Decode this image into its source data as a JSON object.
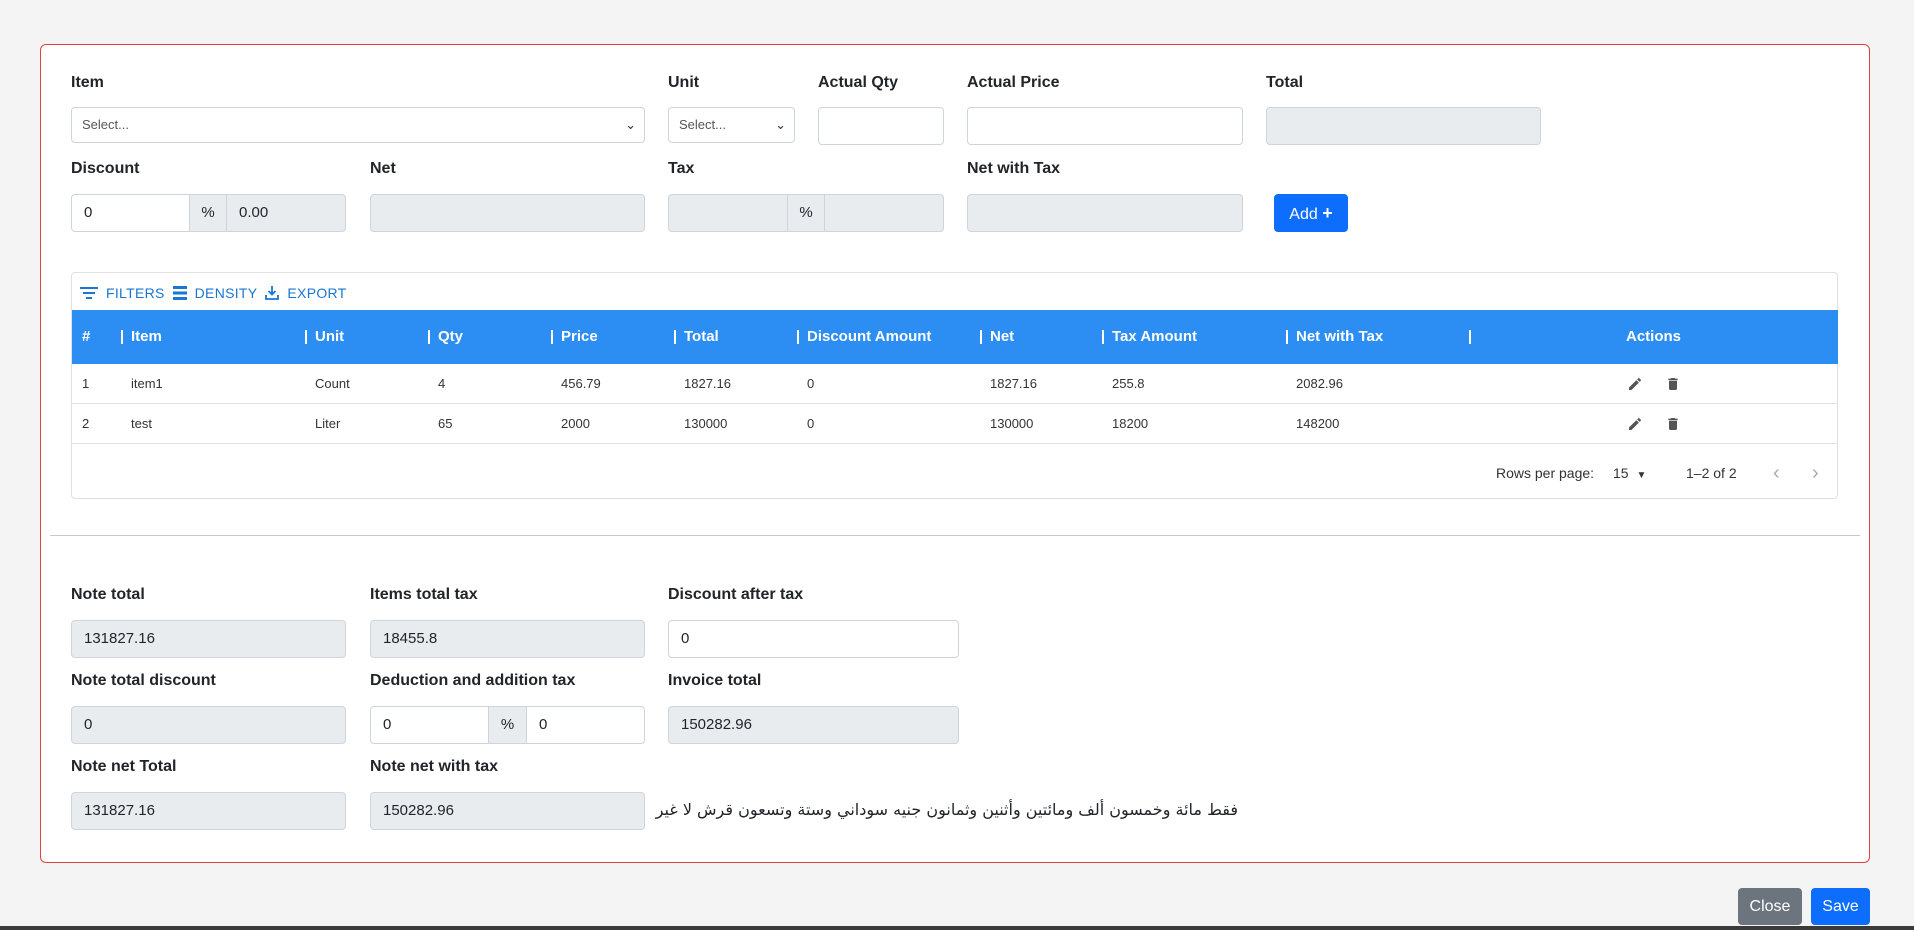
{
  "form": {
    "item_label": "Item",
    "item_placeholder": "Select...",
    "unit_label": "Unit",
    "unit_placeholder": "Select...",
    "actual_qty_label": "Actual Qty",
    "actual_qty_value": "",
    "actual_price_label": "Actual Price",
    "actual_price_value": "",
    "total_label": "Total",
    "total_value": "",
    "discount_label": "Discount",
    "discount_value": "0",
    "discount_percent_symbol": "%",
    "discount_amount": "0.00",
    "net_label": "Net",
    "net_value": "",
    "tax_label": "Tax",
    "tax_value": "",
    "tax_percent_symbol": "%",
    "tax_amount": "",
    "net_with_tax_label": "Net with Tax",
    "net_with_tax_value": "",
    "add_label": "Add",
    "add_icon": "plus-icon"
  },
  "toolbar": {
    "filters_label": "FILTERS",
    "density_label": "DENSITY",
    "export_label": "EXPORT"
  },
  "table": {
    "columns": [
      "#",
      "Item",
      "Unit",
      "Qty",
      "Price",
      "Total",
      "Discount Amount",
      "Net",
      "Tax Amount",
      "Net with Tax",
      "Actions"
    ],
    "rows": [
      {
        "n": "1",
        "item": "item1",
        "unit": "Count",
        "qty": "4",
        "price": "456.79",
        "total": "1827.16",
        "discount": "0",
        "net": "1827.16",
        "tax": "255.8",
        "net_with_tax": "2082.96"
      },
      {
        "n": "2",
        "item": "test",
        "unit": "Liter",
        "qty": "65",
        "price": "2000",
        "total": "130000",
        "discount": "0",
        "net": "130000",
        "tax": "18200",
        "net_with_tax": "148200"
      }
    ],
    "rows_per_page_label": "Rows per page:",
    "rows_per_page_value": "15",
    "range_text": "1–2 of 2"
  },
  "summary": {
    "note_total_label": "Note total",
    "note_total_value": "131827.16",
    "items_total_tax_label": "Items total tax",
    "items_total_tax_value": "18455.8",
    "discount_after_tax_label": "Discount after tax",
    "discount_after_tax_value": "0",
    "note_total_discount_label": "Note total discount",
    "note_total_discount_value": "0",
    "deduction_label": "Deduction and addition tax",
    "deduction_value": "0",
    "deduction_percent_symbol": "%",
    "deduction_amount": "0",
    "invoice_total_label": "Invoice total",
    "invoice_total_value": "150282.96",
    "note_net_total_label": "Note net Total",
    "note_net_total_value": "131827.16",
    "note_net_with_tax_label": "Note net with tax",
    "note_net_with_tax_value": "150282.96",
    "amount_in_words": "فقط مائة وخمسون ألف ومائتين وأثنين وثمانون جنيه سوداني وستة وتسعون قرش لا غير"
  },
  "actions": {
    "close_label": "Close",
    "save_label": "Save"
  },
  "colors": {
    "frame_border": "#e0413f",
    "header_blue": "#2c8df3",
    "primary": "#0d6efd",
    "secondary": "#6c757d",
    "link_blue": "#1976d2"
  }
}
